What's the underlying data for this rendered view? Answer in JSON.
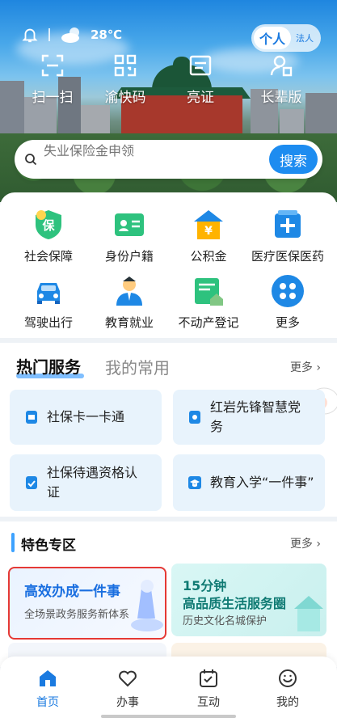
{
  "status": {
    "weather_temp": "28℃"
  },
  "role_toggle": {
    "personal": "个人",
    "corporate": "法人"
  },
  "quick_actions": [
    {
      "label": "扫一扫",
      "icon": "scan-icon"
    },
    {
      "label": "渝快码",
      "icon": "qr-code-icon"
    },
    {
      "label": "亮证",
      "icon": "id-card-icon"
    },
    {
      "label": "长辈版",
      "icon": "elder-mode-icon"
    }
  ],
  "search": {
    "placeholder": "失业保险金申领",
    "button": "搜索"
  },
  "services": [
    {
      "label": "社会保障",
      "icon": "shield-icon"
    },
    {
      "label": "身份户籍",
      "icon": "id-card-icon"
    },
    {
      "label": "公积金",
      "icon": "house-fund-icon"
    },
    {
      "label": "医疗医保医药",
      "icon": "medical-icon"
    },
    {
      "label": "驾驶出行",
      "icon": "car-icon"
    },
    {
      "label": "教育就业",
      "icon": "graduate-icon"
    },
    {
      "label": "不动产登记",
      "icon": "property-icon"
    },
    {
      "label": "更多",
      "icon": "more-icon"
    }
  ],
  "hot_services": {
    "tab_hot": "热门服务",
    "tab_favorites": "我的常用",
    "more": "更多",
    "items": [
      {
        "line1": "社保卡一卡通",
        "line2": ""
      },
      {
        "line1": "红岩先锋智慧党",
        "line2": "务"
      },
      {
        "line1": "社保待遇资格认",
        "line2": "证"
      },
      {
        "line1": "教育入学“一件事”",
        "line2": ""
      }
    ]
  },
  "featured": {
    "title": "特色专区",
    "more": "更多",
    "banner_left": {
      "title": "高效办成一件事",
      "subtitle": "全场景政务服务新体系"
    },
    "banner_right": {
      "title1": "15分钟",
      "title2": "高品质生活服务圈",
      "subtitle": "历史文化名城保护"
    }
  },
  "nav": [
    {
      "label": "首页",
      "icon": "home-icon",
      "active": true
    },
    {
      "label": "办事",
      "icon": "heart-icon",
      "active": false
    },
    {
      "label": "互动",
      "icon": "calendar-check-icon",
      "active": false
    },
    {
      "label": "我的",
      "icon": "smile-icon",
      "active": false
    }
  ],
  "colors": {
    "accent": "#1d8cf0",
    "highlight_border": "#e53935"
  }
}
